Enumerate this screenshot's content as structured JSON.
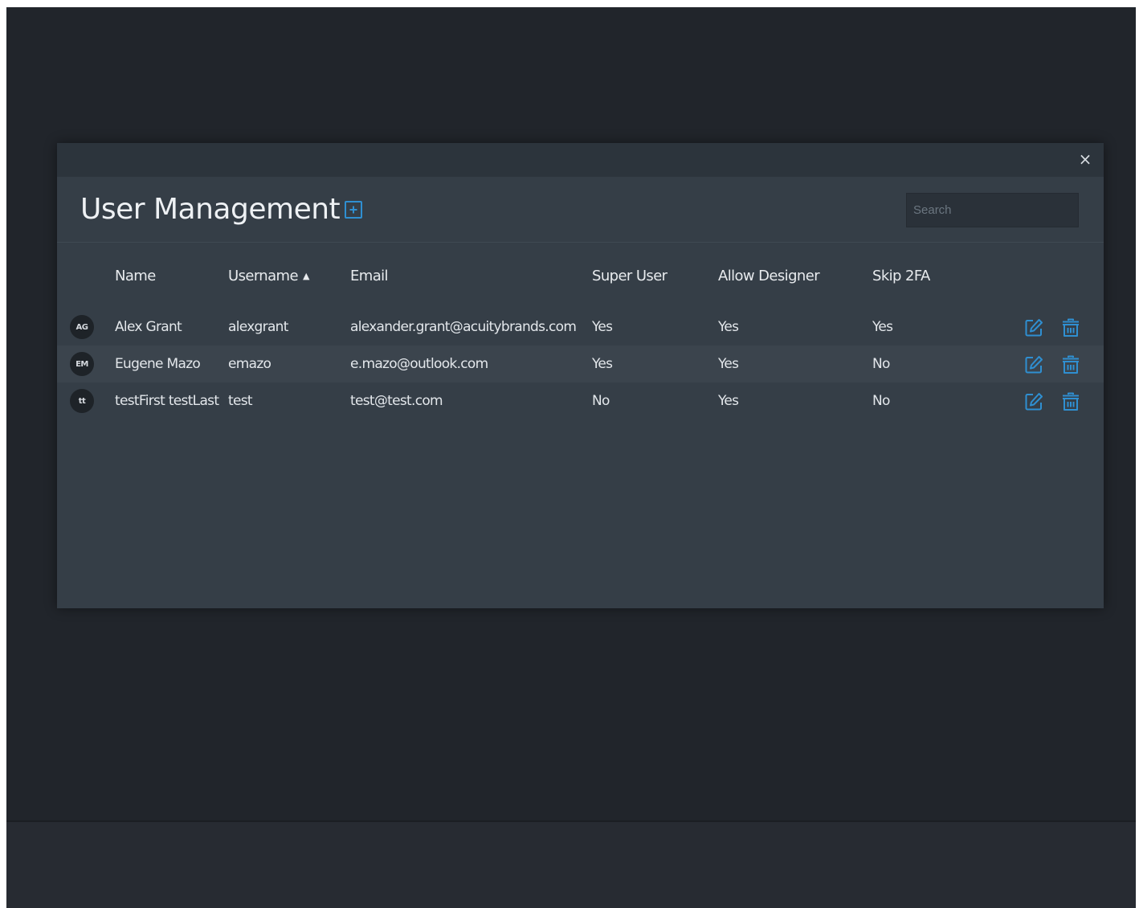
{
  "modal": {
    "close_glyph": "×",
    "title": "User Management",
    "add_icon": "plus-square-icon",
    "search": {
      "placeholder": "Search",
      "value": ""
    }
  },
  "table": {
    "columns": [
      "Name",
      "Username",
      "Email",
      "Super User",
      "Allow Designer",
      "Skip 2FA"
    ],
    "sorted_column": "Username",
    "sort_indicator": "▲",
    "rows": [
      {
        "initials": "AG",
        "name": "Alex Grant",
        "username": "alexgrant",
        "email": "alexander.grant@acuitybrands.com",
        "super_user": "Yes",
        "allow_designer": "Yes",
        "skip_2fa": "Yes"
      },
      {
        "initials": "EM",
        "name": "Eugene Mazo",
        "username": "emazo",
        "email": "e.mazo@outlook.com",
        "super_user": "Yes",
        "allow_designer": "Yes",
        "skip_2fa": "No"
      },
      {
        "initials": "tt",
        "name": "testFirst testLast",
        "username": "test",
        "email": "test@test.com",
        "super_user": "No",
        "allow_designer": "Yes",
        "skip_2fa": "No"
      }
    ],
    "row_actions": [
      "edit-icon",
      "trash-icon"
    ]
  },
  "colors": {
    "background": "#21252b",
    "modal": "#353e47",
    "accent": "#2f8fd1",
    "text": "#e3e7eb"
  }
}
